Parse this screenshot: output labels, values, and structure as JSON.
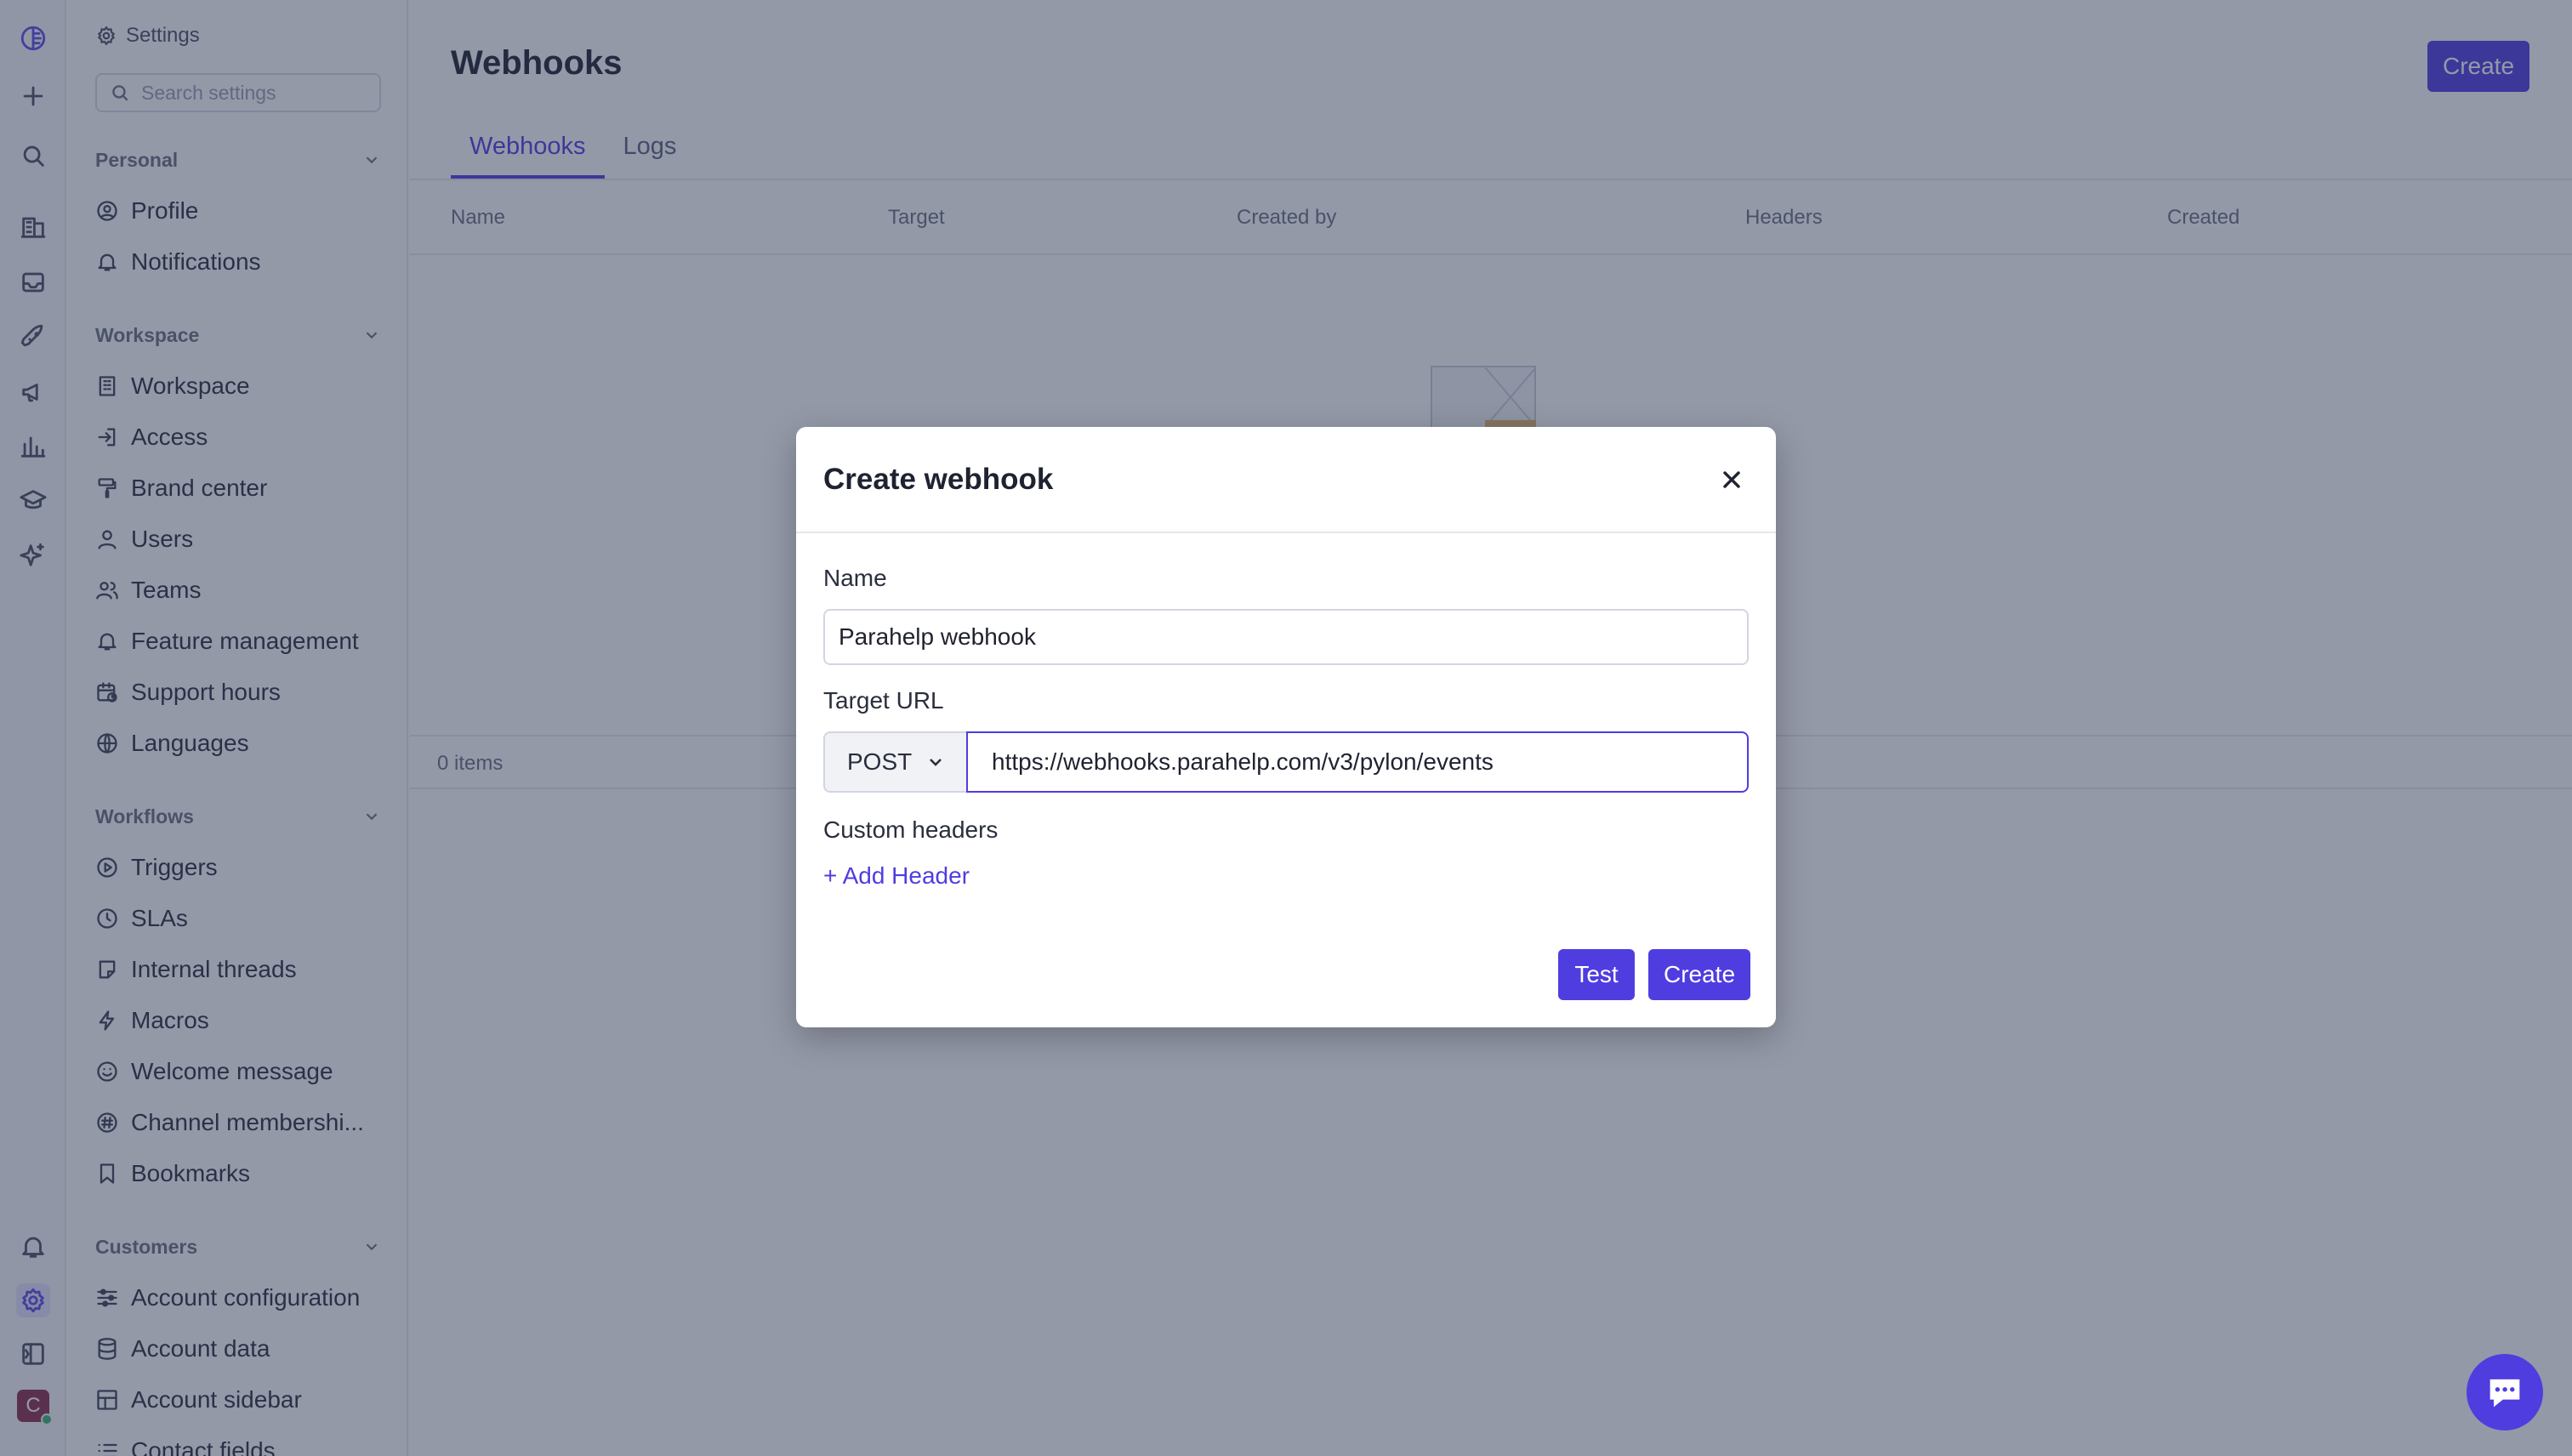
{
  "settings_header": {
    "title": "Settings"
  },
  "search": {
    "placeholder": "Search settings"
  },
  "sections": {
    "personal": "Personal",
    "workspace": "Workspace",
    "workflows": "Workflows",
    "customers": "Customers"
  },
  "items": {
    "profile": "Profile",
    "notifications": "Notifications",
    "workspace": "Workspace",
    "access": "Access",
    "brand_center": "Brand center",
    "users": "Users",
    "teams": "Teams",
    "feature_management": "Feature management",
    "support_hours": "Support hours",
    "languages": "Languages",
    "triggers": "Triggers",
    "slas": "SLAs",
    "internal_threads": "Internal threads",
    "macros": "Macros",
    "welcome_message": "Welcome message",
    "channel_memberships": "Channel membershi...",
    "bookmarks": "Bookmarks",
    "account_configuration": "Account configuration",
    "account_data": "Account data",
    "account_sidebar": "Account sidebar",
    "contact_fields": "Contact fields"
  },
  "avatar": {
    "initial": "C"
  },
  "main": {
    "title": "Webhooks",
    "create_label": "Create",
    "tabs": [
      "Webhooks",
      "Logs"
    ],
    "columns": [
      "Name",
      "Target",
      "Created by",
      "Headers",
      "Created"
    ],
    "item_count": "0 items"
  },
  "modal": {
    "title": "Create webhook",
    "name_label": "Name",
    "name_value": "Parahelp webhook",
    "target_label": "Target URL",
    "method": "POST",
    "url_value": "https://webhooks.parahelp.com/v3/pylon/events",
    "custom_headers_label": "Custom headers",
    "add_header": "+ Add Header",
    "test_label": "Test",
    "create_label": "Create"
  },
  "colors": {
    "accent": "#4f3de0",
    "overlay": "rgba(42,52,82,0.5)"
  }
}
